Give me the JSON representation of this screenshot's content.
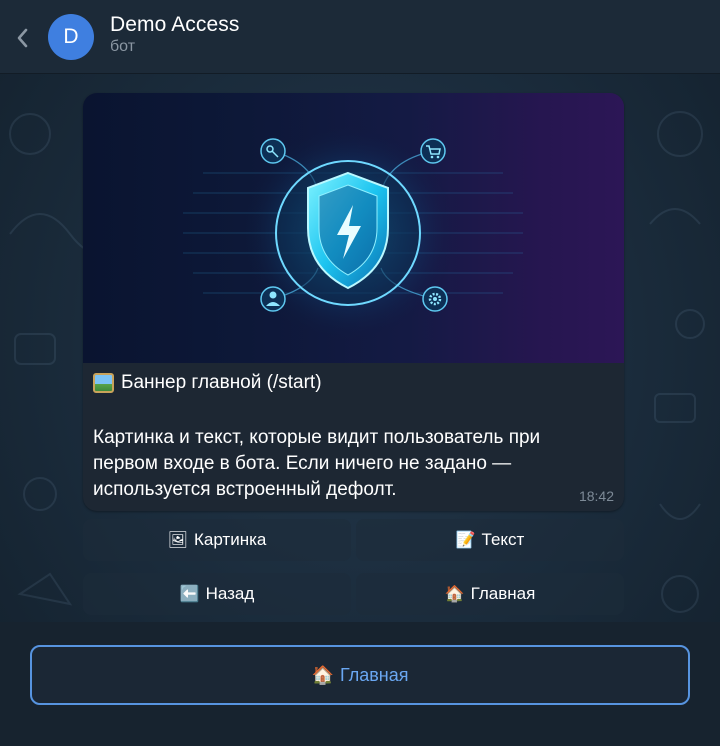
{
  "header": {
    "back_icon": "chevron-left-icon",
    "avatar_letter": "D",
    "avatar_color": "#3f7fe0",
    "title": "Demo Access",
    "subtitle": "бот"
  },
  "message": {
    "banner_icons": [
      "key-icon",
      "cart-icon",
      "user-icon",
      "gear-icon",
      "shield-lightning-icon"
    ],
    "caption_title": "Баннер главной (/start)",
    "caption_lines": [
      "Картинка и текст, которые видит пользователь при",
      "первом входе в бота. Если ничего не задано —",
      "используется встроенный дефолт."
    ],
    "time": "18:42"
  },
  "inline_keyboard": {
    "row1": [
      {
        "icon": "🖼",
        "label": "Картинка"
      },
      {
        "icon": "📝",
        "label": "Текст"
      }
    ],
    "row2": [
      {
        "icon": "⬅️",
        "label": "Назад"
      },
      {
        "icon": "🏠",
        "label": "Главная"
      }
    ]
  },
  "reply_keyboard": {
    "icon": "🏠",
    "label": "Главная"
  },
  "colors": {
    "accent": "#5794e0",
    "bubble": "#1d2733",
    "header": "#1c2a38"
  }
}
